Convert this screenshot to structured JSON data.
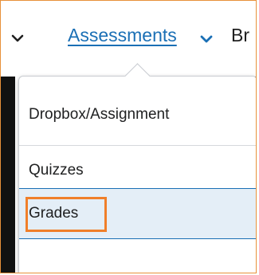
{
  "nav": {
    "assessments_label": "Assessments",
    "next_label_partial": "Br"
  },
  "dropdown": {
    "items": [
      {
        "label": "Dropbox/Assignment"
      },
      {
        "label": "Quizzes"
      },
      {
        "label": "Grades",
        "highlighted": true
      },
      {
        "label": ""
      }
    ]
  },
  "colors": {
    "link": "#1a6fb5",
    "highlight_outline": "#f07f2a",
    "selected_bg": "#e4eef7",
    "frame_border": "#e8913a"
  },
  "icons": {
    "nav_chevron": "chevron-down-icon"
  }
}
